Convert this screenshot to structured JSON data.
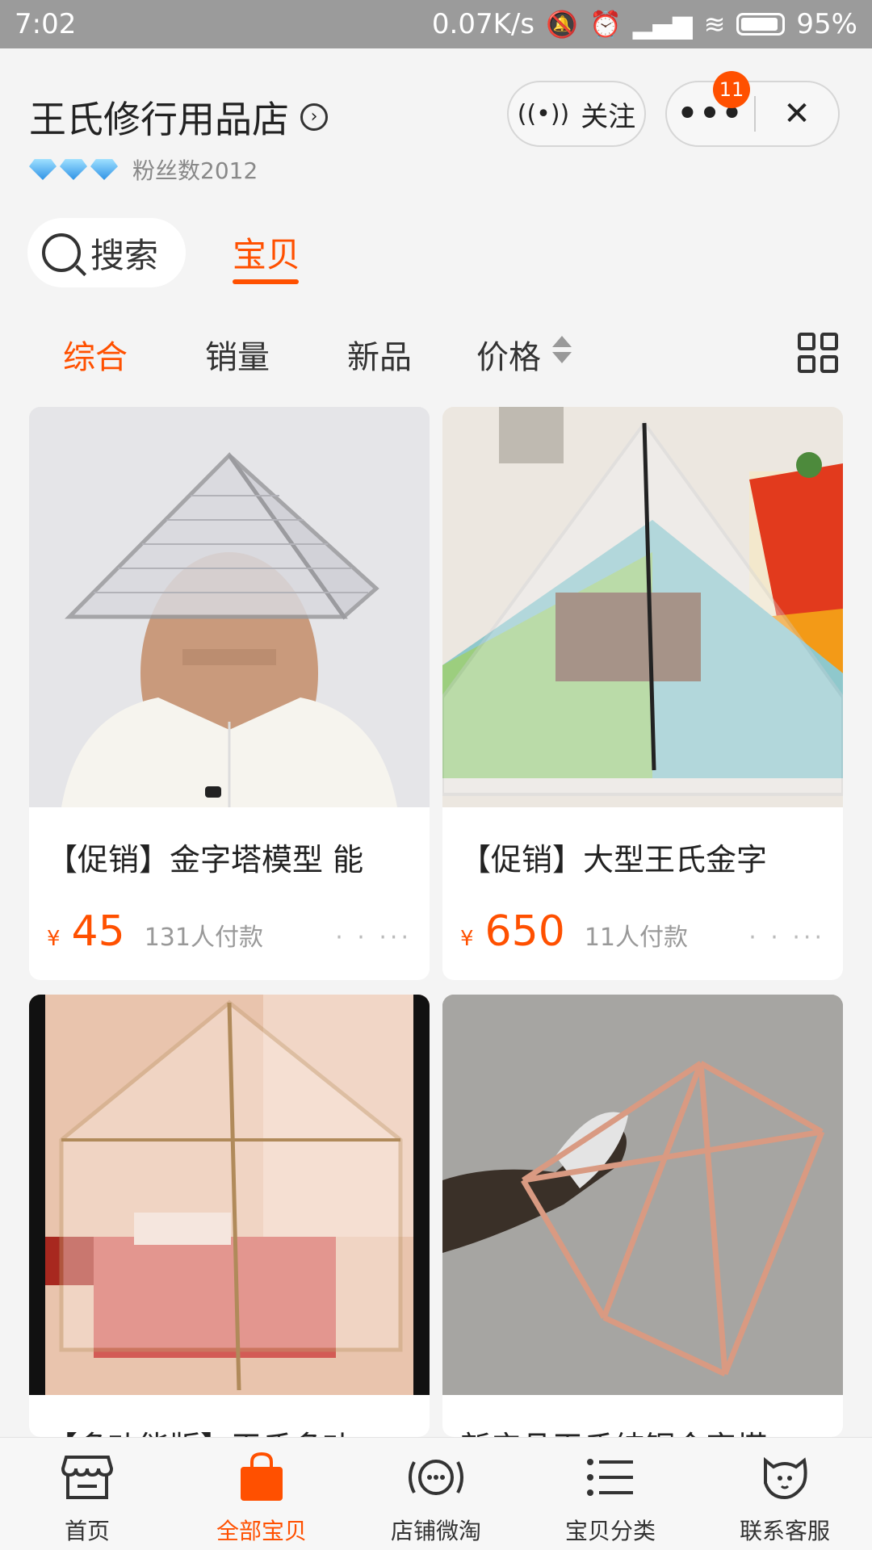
{
  "status": {
    "time": "7:02",
    "network_speed": "0.07K/s",
    "battery": "95%"
  },
  "store": {
    "name": "王氏修行用品店",
    "fans": "粉丝数2012",
    "follow_label": "关注",
    "notification_count": "11",
    "more_label": "•••",
    "close_label": "✕"
  },
  "tabs": {
    "search_label": "搜索",
    "active_tab": "宝贝"
  },
  "sort": {
    "items": [
      "综合",
      "销量",
      "新品",
      "价格"
    ],
    "active": "综合"
  },
  "products": [
    {
      "title": "【促销】金字塔模型 能",
      "currency": "¥",
      "price": "45",
      "sold": "131人付款"
    },
    {
      "title": "【促销】大型王氏金字",
      "currency": "¥",
      "price": "650",
      "sold": "11人付款"
    },
    {
      "title": "【多功能版】王氏多功",
      "currency": "",
      "price": "",
      "sold": ""
    },
    {
      "title": "新产品王氏纯铜金字塔",
      "currency": "",
      "price": "",
      "sold": ""
    }
  ],
  "bottom_nav": {
    "items": [
      "首页",
      "全部宝贝",
      "店铺微淘",
      "宝贝分类",
      "联系客服"
    ],
    "active": "全部宝贝"
  },
  "colors": {
    "accent": "#ff5000",
    "status_bar": "#9b9b9b",
    "background": "#f4f4f4"
  },
  "icons": {
    "follow": "broadcast-icon",
    "grid_toggle": "grid-view-icon",
    "search": "search-icon"
  }
}
